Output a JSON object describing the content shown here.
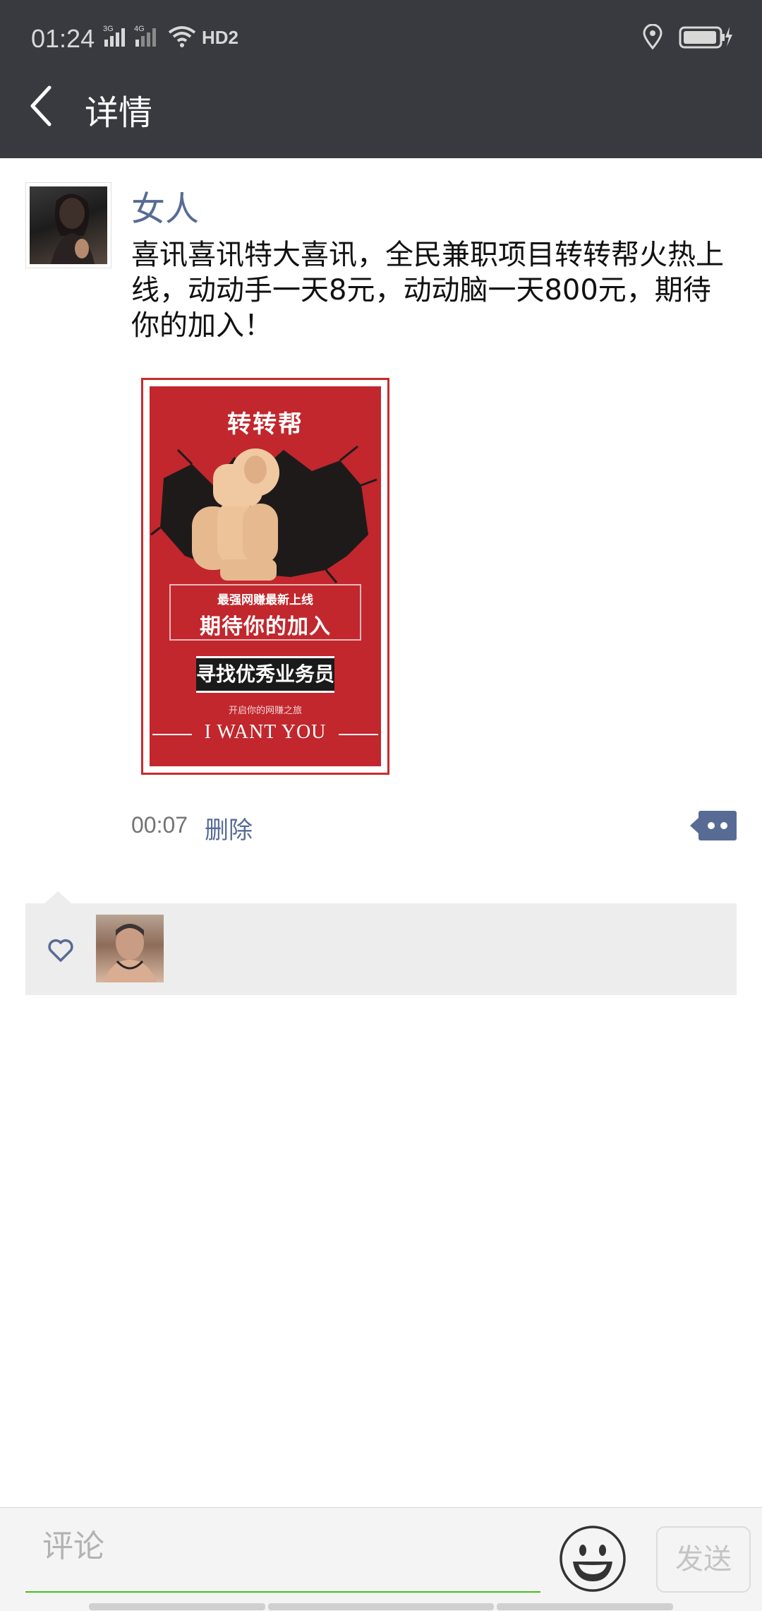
{
  "status_bar": {
    "time": "01:24",
    "signal1_label": "3G",
    "signal2_label": "4G",
    "hd_label": "HD2"
  },
  "header": {
    "title": "详情",
    "back_icon": "chevron-left-icon"
  },
  "post": {
    "username": "女人",
    "text": "喜讯喜讯特大喜讯，全民兼职项目转转帮火热上线，动动手一天8元，动动脑一天800元，期待你的加入！",
    "time": "00:07",
    "delete_label": "删除",
    "poster": {
      "title": "转转帮",
      "line1": "最强网赚最新上线",
      "line2": "期待你的加入",
      "band": "寻找优秀业务员",
      "small": "开启你的网赚之旅",
      "tagline": "I WANT YOU"
    }
  },
  "likes": {
    "icon": "heart-outline-icon",
    "count": 1
  },
  "comment_bar": {
    "placeholder": "评论",
    "send_label": "发送",
    "emoji_icon": "smiley-icon"
  },
  "colors": {
    "header_bg": "#393a3f",
    "link": "#576b95",
    "input_underline": "#45c01a",
    "poster_red": "#c1272d"
  }
}
